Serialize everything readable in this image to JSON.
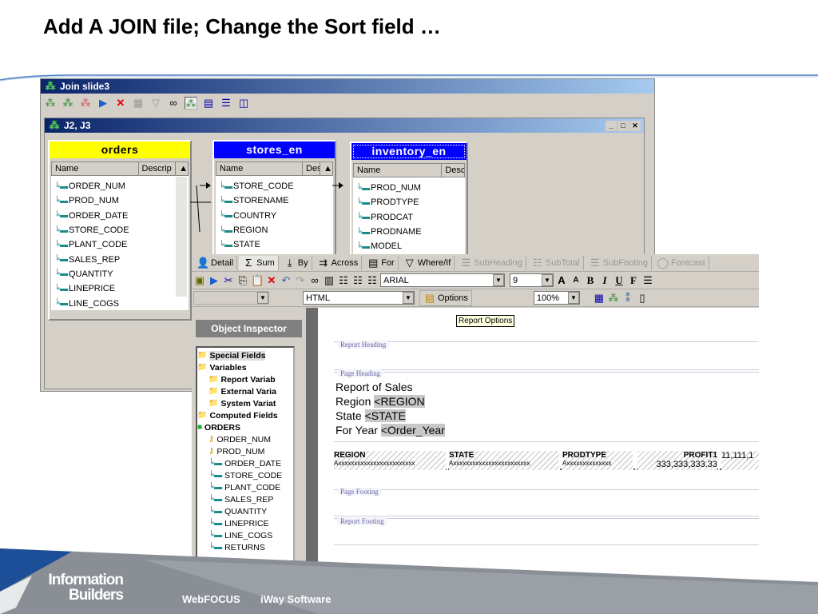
{
  "slide_title": "Add A JOIN file; Change the Sort field …",
  "join_window": {
    "title": "Join slide3",
    "inner_title": "J2, J3",
    "tables": [
      {
        "name": "orders",
        "color": "#ffff00",
        "cols": [
          "Name",
          "Descrip"
        ],
        "fields": [
          "ORDER_NUM",
          "PROD_NUM",
          "ORDER_DATE",
          "STORE_CODE",
          "PLANT_CODE",
          "SALES_REP",
          "QUANTITY",
          "LINEPRICE",
          "LINE_COGS"
        ]
      },
      {
        "name": "stores_en",
        "color": "#0000ff",
        "cols": [
          "Name",
          "Des"
        ],
        "fields": [
          "STORE_CODE",
          "STORENAME",
          "COUNTRY",
          "REGION",
          "STATE"
        ]
      },
      {
        "name": "inventory_en",
        "color": "#0000ff",
        "cols": [
          "Name",
          "Desc"
        ],
        "fields": [
          "PROD_NUM",
          "PRODTYPE",
          "PRODCAT",
          "PRODNAME",
          "MODEL"
        ]
      }
    ]
  },
  "painter": {
    "tabs": [
      "Detail",
      "Sum",
      "By",
      "Across",
      "For",
      "Where/If",
      "SubHeading",
      "SubTotal",
      "SubFooting",
      "Forecast"
    ],
    "font": "ARIAL",
    "size": "9",
    "format": "HTML",
    "options": "Options",
    "zoom": "100%",
    "style_btns": [
      "B",
      "I",
      "U",
      "F"
    ],
    "tooltip": "Report Options",
    "inspector_title": "Object Inspector",
    "tree": [
      {
        "label": "Special Fields",
        "type": "folder",
        "level": 0,
        "bold": true
      },
      {
        "label": "Variables",
        "type": "folder",
        "level": 0,
        "bold": true
      },
      {
        "label": "Report Variab",
        "type": "folder",
        "level": 1,
        "bold": true
      },
      {
        "label": "External Varia",
        "type": "folder",
        "level": 1,
        "bold": true
      },
      {
        "label": "System Variat",
        "type": "folder",
        "level": 1,
        "bold": true
      },
      {
        "label": "Computed Fields",
        "type": "folder",
        "level": 0,
        "bold": true
      },
      {
        "label": "ORDERS",
        "type": "db",
        "level": 0,
        "bold": true
      },
      {
        "label": "ORDER_NUM",
        "type": "key",
        "level": 1
      },
      {
        "label": "PROD_NUM",
        "type": "key",
        "level": 1
      },
      {
        "label": "ORDER_DATE",
        "type": "field",
        "level": 1
      },
      {
        "label": "STORE_CODE",
        "type": "field",
        "level": 1
      },
      {
        "label": "PLANT_CODE",
        "type": "field",
        "level": 1
      },
      {
        "label": "SALES_REP",
        "type": "field",
        "level": 1
      },
      {
        "label": "QUANTITY",
        "type": "field",
        "level": 1
      },
      {
        "label": "LINEPRICE",
        "type": "field",
        "level": 1
      },
      {
        "label": "LINE_COGS",
        "type": "field",
        "level": 1
      },
      {
        "label": "RETURNS",
        "type": "field",
        "level": 1
      }
    ],
    "bands": {
      "report_heading": "Report Heading",
      "page_heading": "Page Heading",
      "page_footing": "Page Footing",
      "report_footing": "Report Footing"
    },
    "heading_lines": [
      [
        "Report of Sales",
        ""
      ],
      [
        "Region ",
        "<REGION"
      ],
      [
        "State ",
        "<STATE"
      ],
      [
        "For Year ",
        "<Order_Year"
      ]
    ],
    "columns": [
      {
        "h": "REGION",
        "v": "Axxxxxxxxxxxxxxxxxxxxxxxx"
      },
      {
        "h": "STATE",
        "v": "Axxxxxxxxxxxxxxxxxxxxxxxx"
      },
      {
        "h": "PRODTYPE",
        "v": "Axxxxxxxxxxxxxx"
      },
      {
        "h": "PROFIT1",
        "v": "333,333,333.33"
      },
      {
        "h": "",
        "v": "11,111,1"
      }
    ]
  },
  "footer": {
    "company_line1": "Information",
    "company_line2": "Builders",
    "product1": "WebFOCUS",
    "product2": "iWay Software"
  }
}
